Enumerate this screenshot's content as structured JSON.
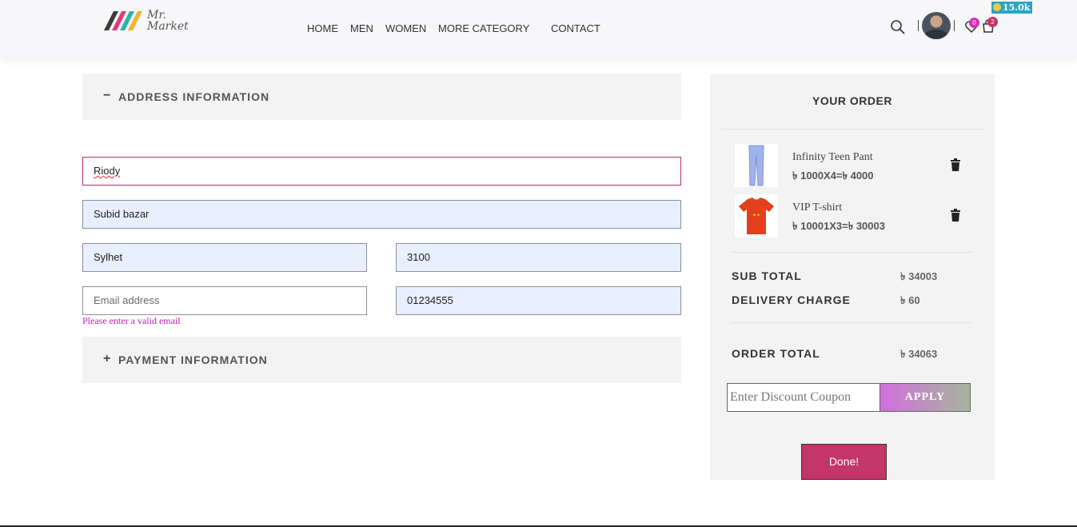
{
  "header": {
    "logo_text_line1": "Mr.",
    "logo_text_line2": "Market",
    "nav": [
      "HOME",
      "MEN",
      "WOMEN",
      "MORE CATEGORY",
      "CONTACT"
    ],
    "wishlist_count": "0",
    "cart_count": "2",
    "coins": "15.0k",
    "icons": [
      "search-icon",
      "avatar",
      "heart-icon",
      "cart-icon",
      "coin-icon"
    ]
  },
  "address": {
    "heading": "ADDRESS INFORMATION",
    "toggle": "−",
    "name": "Riody",
    "street": "Subid bazar",
    "city": "Sylhet",
    "postcode": "3100",
    "email_placeholder": "Email address",
    "phone": "01234555",
    "email_error": "Please enter a valid email"
  },
  "payment": {
    "heading": "PAYMENT INFORMATION",
    "toggle": "+"
  },
  "order": {
    "title": "YOUR ORDER",
    "items": [
      {
        "name": "Infinity Teen Pant",
        "price": "৳ 1000X4=৳ 4000"
      },
      {
        "name": "VIP T-shirt",
        "price": "৳ 10001X3=৳ 30003"
      }
    ],
    "subtotal_label": "SUB TOTAL",
    "subtotal_value": "৳ 34003",
    "delivery_label": "DELIVERY CHARGE",
    "delivery_value": "৳ 60",
    "total_label": "ORDER TOTAL",
    "total_value": "৳ 34063",
    "coupon_placeholder": "Enter Discount Coupon",
    "apply_label": "APPLY",
    "done_label": "Done!"
  },
  "colors": {
    "accent": "#c43568",
    "error": "#c41bb4",
    "panel": "#f3f3f3",
    "autofill": "#e8f0fe"
  }
}
